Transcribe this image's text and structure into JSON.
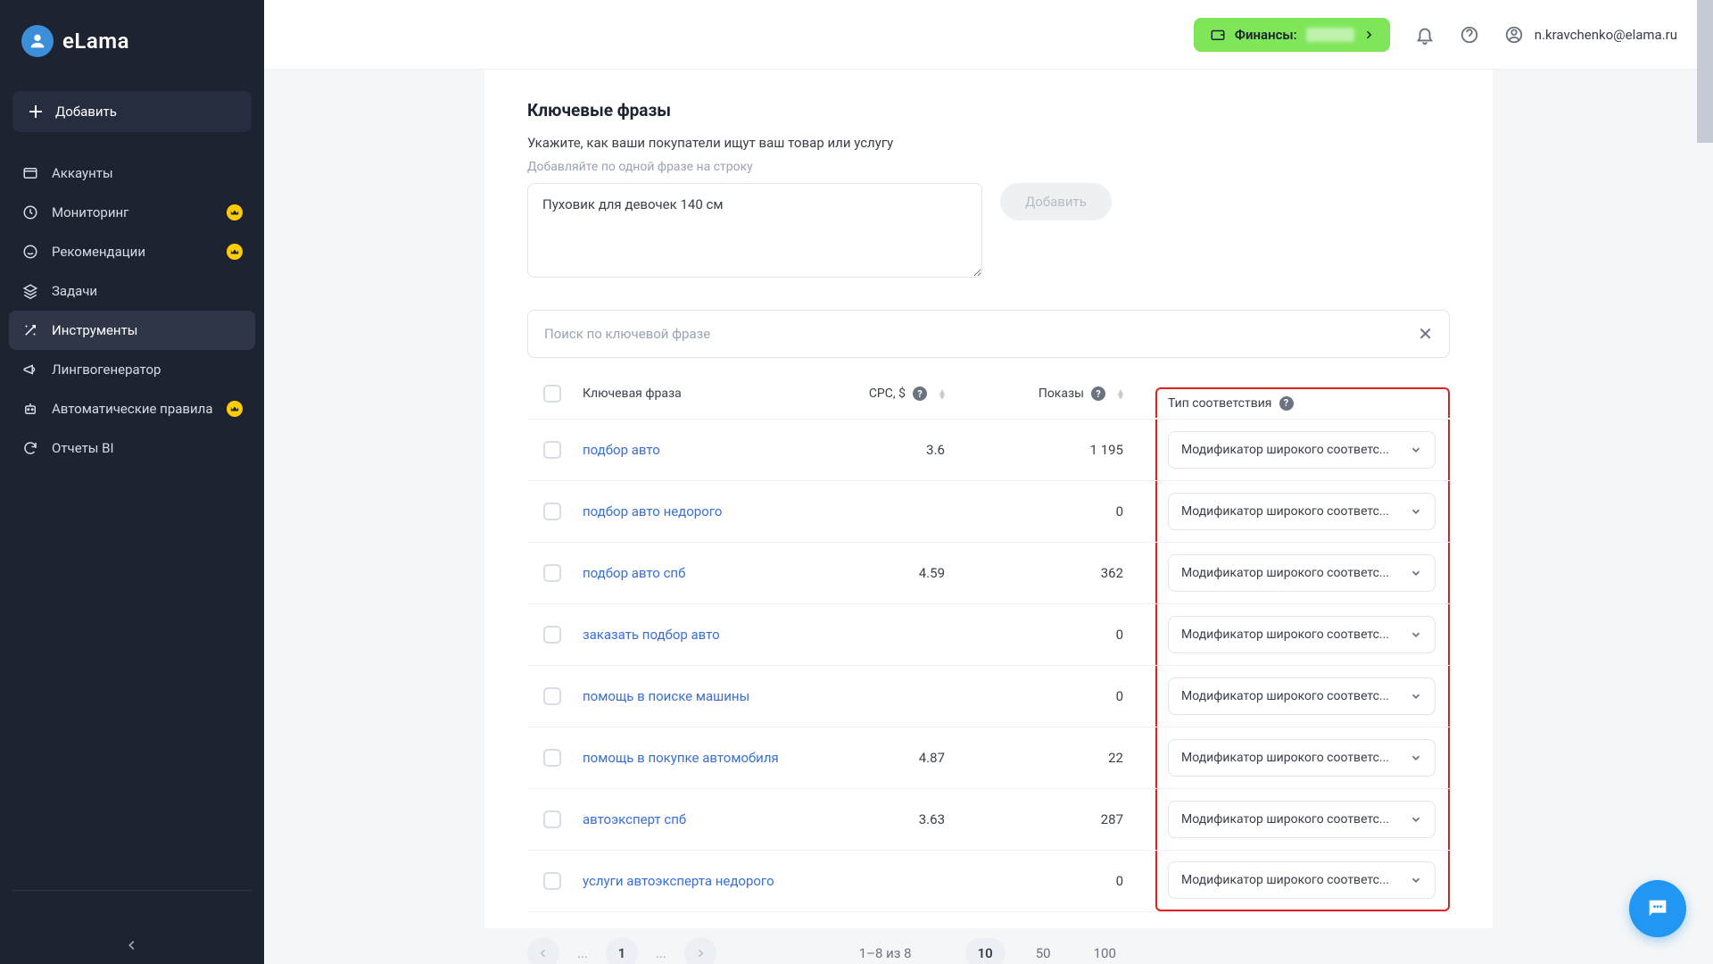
{
  "brand": "eLama",
  "sidebar": {
    "add_label": "Добавить",
    "items": [
      {
        "label": "Аккаунты",
        "badge": false
      },
      {
        "label": "Мониторинг",
        "badge": true
      },
      {
        "label": "Рекомендации",
        "badge": true
      },
      {
        "label": "Задачи",
        "badge": false
      },
      {
        "label": "Инструменты",
        "badge": false
      },
      {
        "label": "Лингвогенератор",
        "badge": false
      },
      {
        "label": "Автоматические правила",
        "badge": true
      },
      {
        "label": "Отчеты BI",
        "badge": false
      }
    ]
  },
  "topbar": {
    "finance_label": "Финансы:",
    "user_email": "n.kravchenko@elama.ru"
  },
  "section": {
    "title": "Ключевые фразы",
    "desc": "Укажите, как ваши покупатели ищут ваш товар или услугу",
    "hint": "Добавляйте по одной фразе на строку",
    "textarea_value": "Пуховик для девочек 140 см",
    "add_btn": "Добавить",
    "search_placeholder": "Поиск по ключевой фразе"
  },
  "table": {
    "headers": {
      "keyword": "Ключевая фраза",
      "cpc": "CPC, $",
      "impressions": "Показы",
      "match": "Тип соответствия"
    },
    "match_option": "Модификатор широкого соответс...",
    "rows": [
      {
        "keyword": "подбор авто",
        "cpc": "3.6",
        "impressions": "1 195"
      },
      {
        "keyword": "подбор авто недорого",
        "cpc": "",
        "impressions": "0"
      },
      {
        "keyword": "подбор авто спб",
        "cpc": "4.59",
        "impressions": "362"
      },
      {
        "keyword": "заказать подбор авто",
        "cpc": "",
        "impressions": "0"
      },
      {
        "keyword": "помощь в поиске машины",
        "cpc": "",
        "impressions": "0"
      },
      {
        "keyword": "помощь в покупке автомобиля",
        "cpc": "4.87",
        "impressions": "22"
      },
      {
        "keyword": "автоэксперт спб",
        "cpc": "3.63",
        "impressions": "287"
      },
      {
        "keyword": "услуги автоэксперта недорого",
        "cpc": "",
        "impressions": "0"
      }
    ]
  },
  "pagination": {
    "current": "1",
    "info": "1–8 из 8",
    "sizes": [
      "10",
      "50",
      "100"
    ],
    "active_size": "10"
  }
}
